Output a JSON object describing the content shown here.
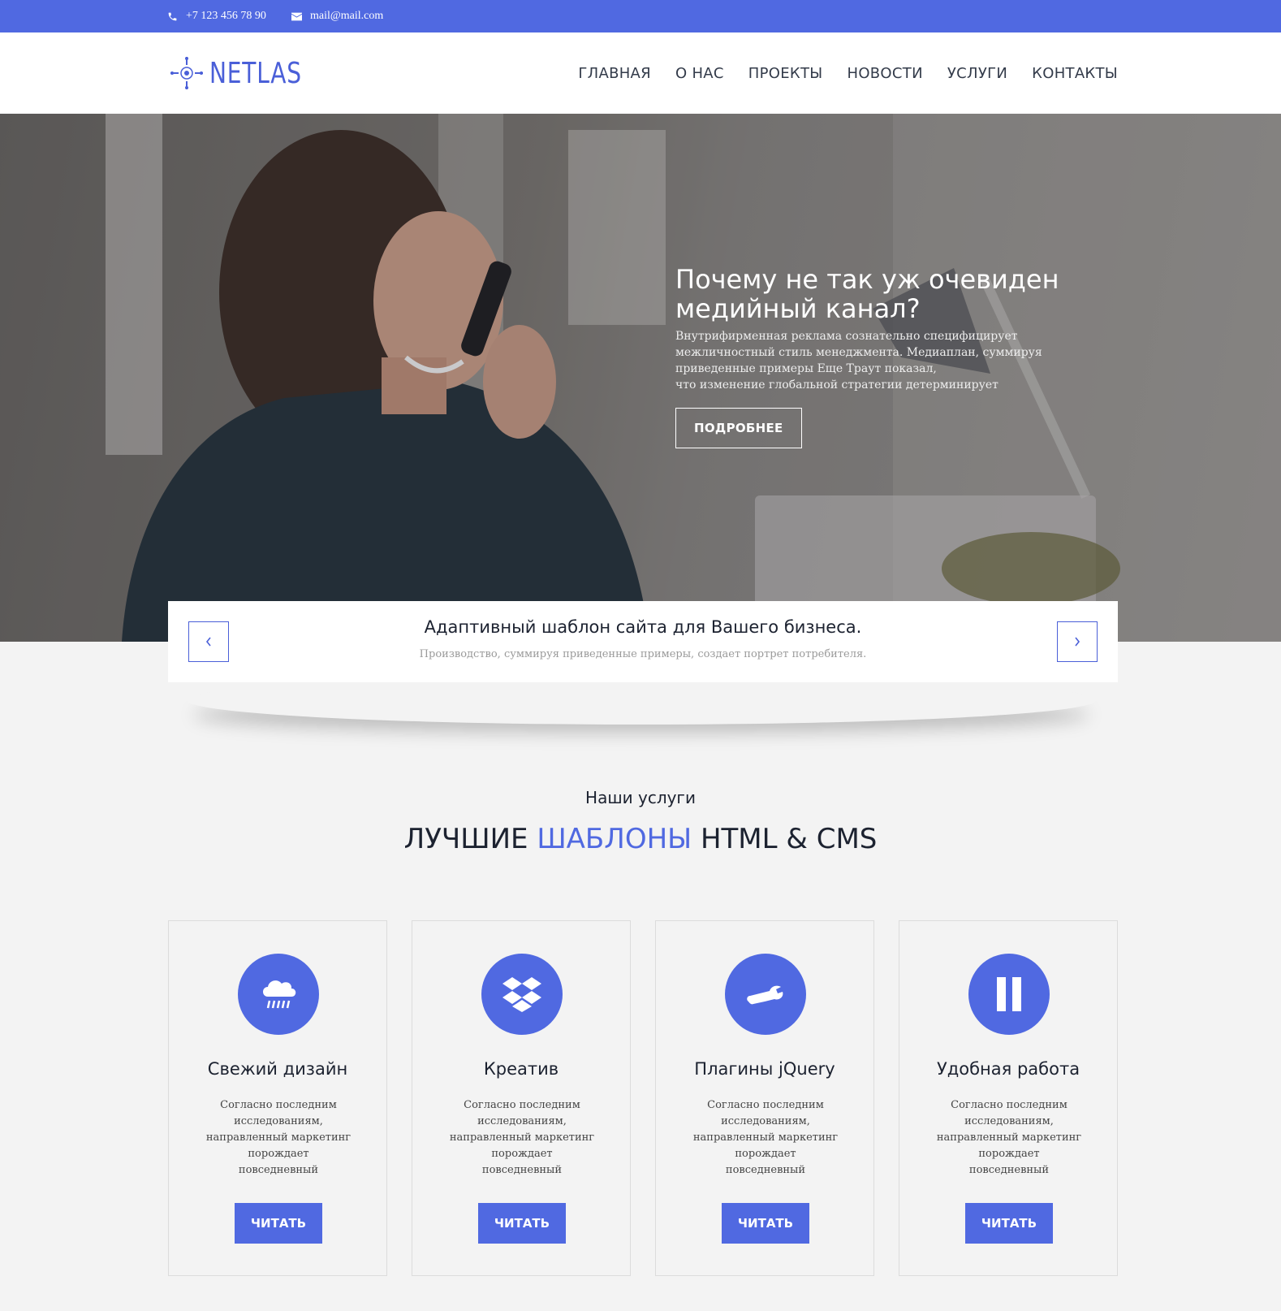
{
  "colors": {
    "accent": "#5069e1",
    "dark_text": "#1c2230",
    "background": "#f3f3f3"
  },
  "topbar": {
    "phone": "+7 123 456 78 90",
    "email": "mail@mail.com",
    "phone_icon": "phone-icon",
    "email_icon": "envelope-icon"
  },
  "header": {
    "logo_text": "NETLAS",
    "nav": [
      {
        "label": "ГЛАВНАЯ"
      },
      {
        "label": "О НАС"
      },
      {
        "label": "ПРОЕКТЫ"
      },
      {
        "label": "НОВОСТИ"
      },
      {
        "label": "УСЛУГИ"
      },
      {
        "label": "КОНТАКТЫ"
      }
    ]
  },
  "hero": {
    "title_line1": "Почему не так уж очевиден",
    "title_line2": "медийный канал?",
    "text_lines": [
      "Внутрифирменная реклама сознательно специфицирует",
      "межличностный стиль менеджмента. Медиаплан, суммируя",
      "приведенные примеры Еще Траут показал,",
      "что изменение глобальной стратегии детерминирует"
    ],
    "button": "ПОДРОБНЕЕ"
  },
  "slider": {
    "title": "Адаптивный шаблон сайта для Вашего бизнеса.",
    "subtitle": "Производство, суммируя приведенные примеры, создает портрет потребителя."
  },
  "services": {
    "kicker": "Наши услуги",
    "heading_part1": "ЛУЧШИЕ ",
    "heading_accent": "ШАБЛОНЫ",
    "heading_part2": " HTML & CMS",
    "cards": [
      {
        "icon": "cloud-rain-icon",
        "title": "Свежий дизайн",
        "lines": [
          "Согласно последним",
          "исследованиям,",
          "направленный маркетинг",
          "порождает",
          "повседневный"
        ],
        "button": "ЧИТАТЬ"
      },
      {
        "icon": "dropbox-icon",
        "title": "Креатив",
        "lines": [
          "Согласно последним",
          "исследованиям,",
          "направленный маркетинг",
          "порождает",
          "повседневный"
        ],
        "button": "ЧИТАТЬ"
      },
      {
        "icon": "wrench-icon",
        "title": "Плагины jQuery",
        "lines": [
          "Согласно последним",
          "исследованиям,",
          "направленный маркетинг",
          "порождает",
          "повседневный"
        ],
        "button": "ЧИТАТЬ"
      },
      {
        "icon": "pause-icon",
        "title": "Удобная работа",
        "lines": [
          "Согласно последним",
          "исследованиям,",
          "направленный маркетинг",
          "порождает",
          "повседневный"
        ],
        "button": "ЧИТАТЬ"
      }
    ]
  }
}
